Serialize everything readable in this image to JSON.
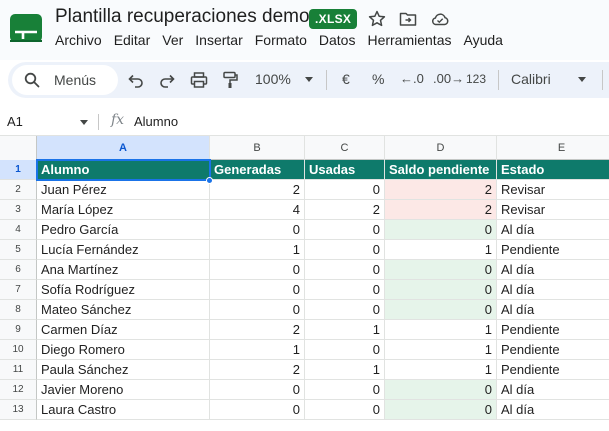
{
  "app": {
    "title": "Plantilla recuperaciones demo",
    "file_badge": "XLSX",
    "title_icons": [
      "star-icon",
      "move-to-folder-icon",
      "cloud-saved-icon"
    ],
    "logo_icon": "sheets-logo-icon",
    "brand_color": "#188038"
  },
  "menu": [
    "Archivo",
    "Editar",
    "Ver",
    "Insertar",
    "Formato",
    "Datos",
    "Herramientas",
    "Ayuda"
  ],
  "toolbar": {
    "search_label": "Menús",
    "zoom": "100%",
    "currency": "€",
    "percent": "%",
    "decrease_decimals": ".0",
    "increase_decimals": ".00",
    "number_format": "123",
    "font": "Calibri"
  },
  "formula_bar": {
    "cell_ref": "A1",
    "fx": "fx",
    "content": "Alumno"
  },
  "columns": [
    "A",
    "B",
    "C",
    "D",
    "E"
  ],
  "header_color": "#0e7a6b",
  "highlight_colors": {
    "pending": "#fce8e6",
    "clear": "#e6f4ea"
  },
  "table": {
    "headers": [
      "Alumno",
      "Generadas",
      "Usadas",
      "Saldo pendiente",
      "Estado"
    ],
    "rows": [
      {
        "num": "2",
        "alumno": "Juan Pérez",
        "generadas": "2",
        "usadas": "0",
        "saldo": "2",
        "estado": "Revisar",
        "hl": "pink"
      },
      {
        "num": "3",
        "alumno": "María López",
        "generadas": "4",
        "usadas": "2",
        "saldo": "2",
        "estado": "Revisar",
        "hl": "pink"
      },
      {
        "num": "4",
        "alumno": "Pedro García",
        "generadas": "0",
        "usadas": "0",
        "saldo": "0",
        "estado": "Al día",
        "hl": "green"
      },
      {
        "num": "5",
        "alumno": "Lucía Fernández",
        "generadas": "1",
        "usadas": "0",
        "saldo": "1",
        "estado": "Pendiente",
        "hl": ""
      },
      {
        "num": "6",
        "alumno": "Ana Martínez",
        "generadas": "0",
        "usadas": "0",
        "saldo": "0",
        "estado": "Al día",
        "hl": "green"
      },
      {
        "num": "7",
        "alumno": "Sofía Rodríguez",
        "generadas": "0",
        "usadas": "0",
        "saldo": "0",
        "estado": "Al día",
        "hl": "green"
      },
      {
        "num": "8",
        "alumno": "Mateo Sánchez",
        "generadas": "0",
        "usadas": "0",
        "saldo": "0",
        "estado": "Al día",
        "hl": "green"
      },
      {
        "num": "9",
        "alumno": "Carmen Díaz",
        "generadas": "2",
        "usadas": "1",
        "saldo": "1",
        "estado": "Pendiente",
        "hl": ""
      },
      {
        "num": "10",
        "alumno": "Diego Romero",
        "generadas": "1",
        "usadas": "0",
        "saldo": "1",
        "estado": "Pendiente",
        "hl": ""
      },
      {
        "num": "11",
        "alumno": "Paula Sánchez",
        "generadas": "2",
        "usadas": "1",
        "saldo": "1",
        "estado": "Pendiente",
        "hl": ""
      },
      {
        "num": "12",
        "alumno": "Javier Moreno",
        "generadas": "0",
        "usadas": "0",
        "saldo": "0",
        "estado": "Al día",
        "hl": "green"
      },
      {
        "num": "13",
        "alumno": "Laura Castro",
        "generadas": "0",
        "usadas": "0",
        "saldo": "0",
        "estado": "Al día",
        "hl": "green"
      }
    ]
  }
}
